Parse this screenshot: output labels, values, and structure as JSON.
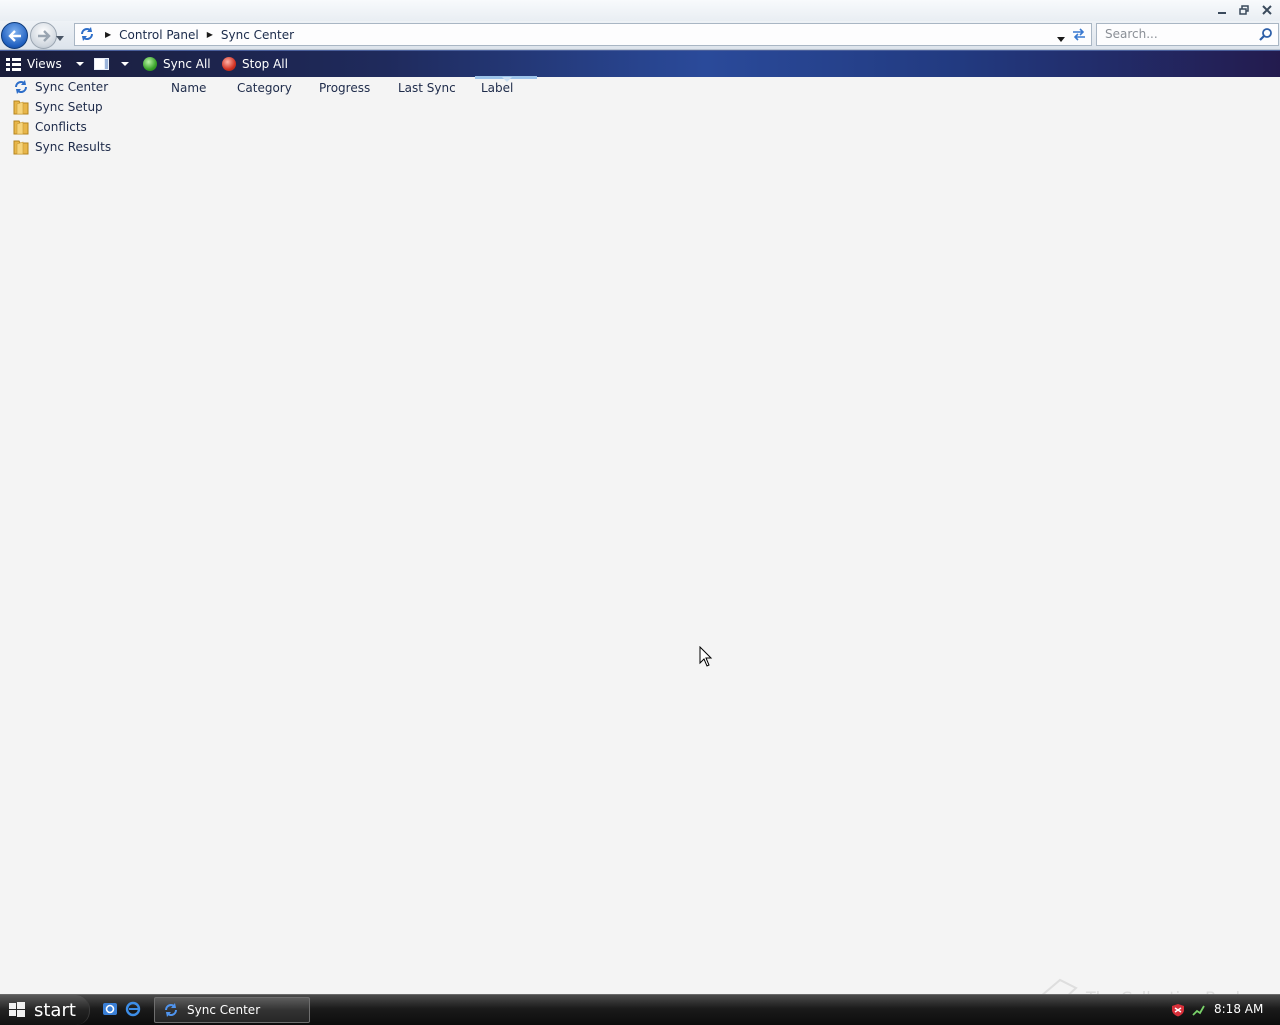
{
  "window": {
    "title": "Sync Center",
    "controls": [
      "minimize-icon",
      "restore-icon",
      "close-icon"
    ]
  },
  "address_bar": {
    "breadcrumbs": [
      "Control Panel",
      "Sync Center"
    ],
    "search_placeholder": "Search..."
  },
  "command_bar": {
    "views_label": "Views",
    "sync_all_label": "Sync All",
    "stop_all_label": "Stop All"
  },
  "sidebar": {
    "items": [
      {
        "label": "Sync Center",
        "icon": "sync-icon"
      },
      {
        "label": "Sync Setup",
        "icon": "folder-icon"
      },
      {
        "label": "Conflicts",
        "icon": "folder-icon"
      },
      {
        "label": "Sync Results",
        "icon": "folder-icon"
      }
    ]
  },
  "list": {
    "columns": [
      "Name",
      "Category",
      "Progress",
      "Last Sync",
      "Label"
    ],
    "sorted_column": "Label"
  },
  "taskbar": {
    "start_label": "start",
    "active_task": "Sync Center",
    "clock": "8:18 AM"
  },
  "watermark": "The Collection Book",
  "colors": {
    "command_bar": "#1f2a5c",
    "background": "#f4f4f4",
    "accent": "#2a4a9a"
  }
}
